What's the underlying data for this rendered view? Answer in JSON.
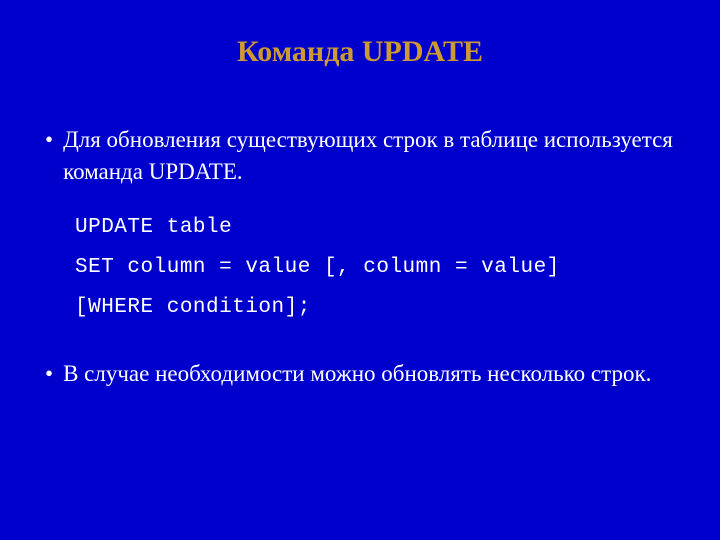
{
  "title": "Команда UPDATE",
  "bullets": [
    "Для обновления существующих строк в таблице используется команда UPDATE.",
    "В случае необходимости можно обновлять несколько строк."
  ],
  "code": {
    "line1": "UPDATE table",
    "line2": "SET column = value [, column = value]",
    "line3": "[WHERE condition];"
  }
}
